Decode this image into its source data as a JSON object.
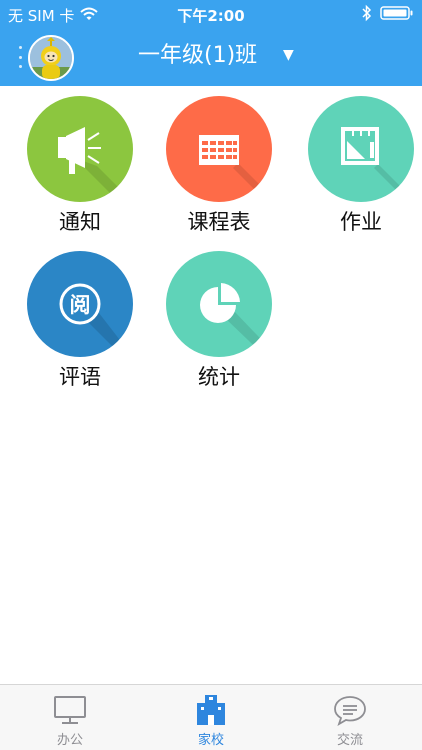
{
  "status_bar": {
    "carrier": "无 SIM 卡",
    "time": "下午2:00"
  },
  "header": {
    "class_name": "一年级(1)班"
  },
  "modules": [
    {
      "label": "通知",
      "icon": "megaphone-icon",
      "color": "#8cc63f"
    },
    {
      "label": "课程表",
      "icon": "timetable-icon",
      "color": "#fe6b48"
    },
    {
      "label": "作业",
      "icon": "ruler-icon",
      "color": "#5fd3b8"
    },
    {
      "label": "评语",
      "icon": "read-icon",
      "color": "#2b86c6"
    },
    {
      "label": "统计",
      "icon": "pie-chart-icon",
      "color": "#5fd3b8"
    }
  ],
  "tabs": [
    {
      "label": "办公",
      "icon": "monitor-icon",
      "active": false
    },
    {
      "label": "家校",
      "icon": "school-icon",
      "active": true
    },
    {
      "label": "交流",
      "icon": "chat-icon",
      "active": false
    }
  ],
  "colors": {
    "brand": "#3aa3ef",
    "tab_active": "#2e86de",
    "tab_inactive": "#8e8e93"
  }
}
